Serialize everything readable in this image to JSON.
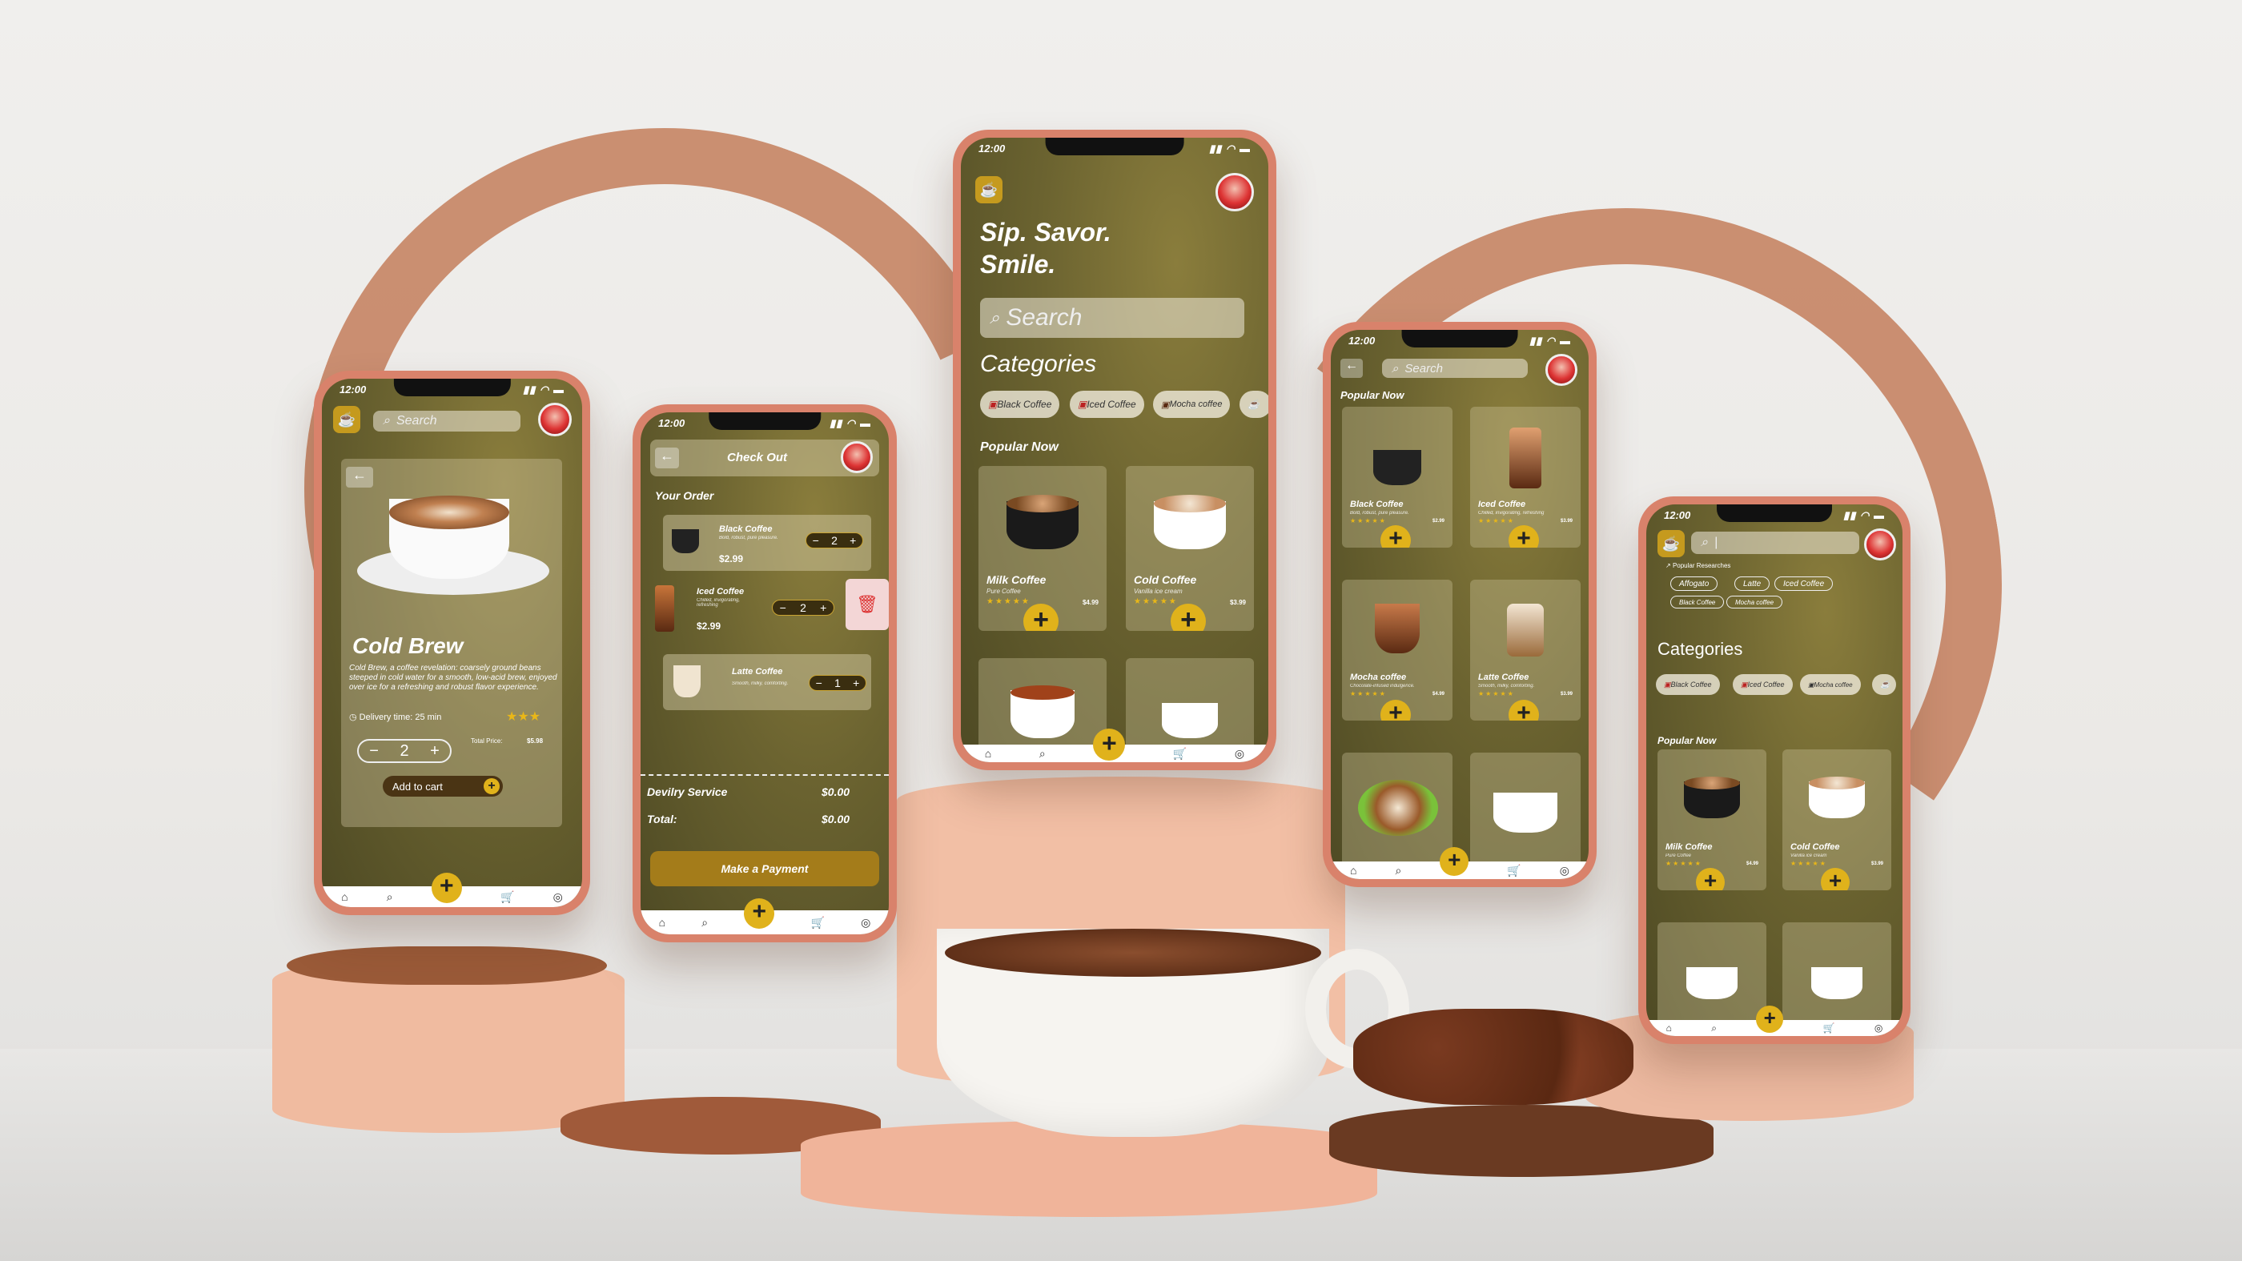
{
  "status_time": "12:00",
  "nav_icons": [
    "home-icon",
    "search-icon",
    "add-icon",
    "cart-icon",
    "profile-icon"
  ],
  "colors": {
    "accent": "#e0b21b",
    "phone_frame": "#d9826b",
    "screen_bg": "#6b6330",
    "ribbon": "#c98a6b"
  },
  "detail": {
    "search_placeholder": "Search",
    "title": "Cold Brew",
    "description": "Cold Brew, a coffee revelation: coarsely ground beans steeped in cold water for a smooth, low-acid brew, enjoyed over ice for a refreshing and robust flavor experience.",
    "delivery": "Delivery time: 25 min",
    "quantity": "2",
    "minus": "−",
    "plus": "+",
    "total_label": "Total Price:",
    "total_value": "$5.98",
    "add_to_cart": "Add to cart",
    "rating": 3
  },
  "checkout": {
    "title": "Check Out",
    "your_order": "Your Order",
    "items": [
      {
        "name": "Black Coffee",
        "desc": "Bold, robust, pure pleasure.",
        "price": "$2.99",
        "qty": "2"
      },
      {
        "name": "Iced Coffee",
        "desc": "Chilled, invigorating, refreshing",
        "price": "$2.99",
        "qty": "2"
      },
      {
        "name": "Latte Coffee",
        "desc": "Smooth, milky, comforting.",
        "price": "",
        "qty": "1"
      }
    ],
    "delivery_label": "Devilry Service",
    "delivery_value": "$0.00",
    "total_label": "Total:",
    "total_value": "$0.00",
    "pay_button": "Make a Payment"
  },
  "home": {
    "headline_1": "Sip. Savor.",
    "headline_2": "Smile.",
    "search_placeholder": "Search",
    "categories_title": "Categories",
    "categories": [
      "Black Coffee",
      "Iced Coffee",
      "Mocha coffee"
    ],
    "popular_title": "Popular Now",
    "products": [
      {
        "name": "Milk Coffee",
        "desc": "Pure Coffee",
        "price": "$4.99"
      },
      {
        "name": "Cold Coffee",
        "desc": "Vanilla ice cream",
        "price": "$3.99"
      }
    ]
  },
  "popular": {
    "search_placeholder": "Search",
    "popular_title": "Popular Now",
    "products": [
      {
        "name": "Black Coffee",
        "desc": "Bold, robust, pure pleasure.",
        "price": "$2.99"
      },
      {
        "name": "Iced Coffee",
        "desc": "Chilled, invigorating, refreshing",
        "price": "$3.99"
      },
      {
        "name": "Mocha coffee",
        "desc": "Chocolate-infused indulgence.",
        "price": "$4.99"
      },
      {
        "name": "Latte Coffee",
        "desc": "Smooth, milky, comforting.",
        "price": "$3.99"
      }
    ]
  },
  "search_screen": {
    "popular_searches_title": "Popular Researches",
    "tags": [
      "Affogato",
      "Latte",
      "Iced Coffee",
      "Black Coffee",
      "Mocha coffee"
    ],
    "categories_title": "Categories",
    "categories": [
      "Black Coffee",
      "Iced Coffee",
      "Mocha coffee"
    ],
    "popular_title": "Popular Now",
    "products": [
      {
        "name": "Milk Coffee",
        "desc": "Pure Coffee",
        "price": "$4.99"
      },
      {
        "name": "Cold Coffee",
        "desc": "Vanilla ice cream",
        "price": "$3.99"
      }
    ]
  }
}
